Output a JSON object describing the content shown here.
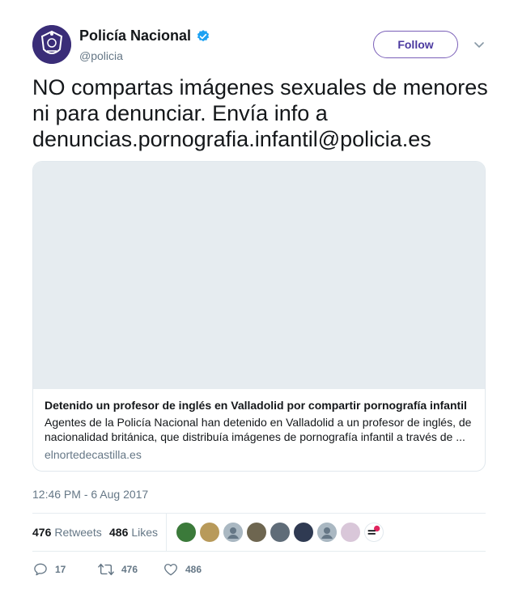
{
  "author": {
    "display_name": "Policía Nacional",
    "handle": "@policia",
    "verified": true,
    "avatar_color": "#3a2d78"
  },
  "follow_button": {
    "label": "Follow",
    "border_color": "#7a5fb8"
  },
  "tweet": {
    "text": "NO compartas imágenes sexuales de menores ni para denunciar. Envía info a denuncias.pornografia.infantil@policia.es",
    "timestamp": "12:46 PM - 6 Aug 2017"
  },
  "card": {
    "title": "Detenido un profesor de inglés en Valladolid por compartir pornografía infantil",
    "description": "Agentes de la Policía Nacional han detenido en Valladolid a un profesor de inglés, de nacionalidad británica, que distribuía imágenes de pornografía infantil a través de ...",
    "domain": "elnortedecastilla.es"
  },
  "stats": {
    "retweets_count": "476",
    "retweets_label": "Retweets",
    "likes_count": "486",
    "likes_label": "Likes"
  },
  "likers": [
    {
      "color": "#3b7a3a"
    },
    {
      "color": "#b89a5a"
    },
    {
      "color": "#aab8c2"
    },
    {
      "color": "#6e6650"
    },
    {
      "color": "#5f6c78"
    },
    {
      "color": "#2f3a52"
    },
    {
      "color": "#aab8c2"
    },
    {
      "color": "#d9c7d9"
    },
    {
      "color": "#ffffff"
    }
  ],
  "actions": {
    "replies": "17",
    "retweets": "476",
    "likes": "486"
  },
  "icons": {
    "verified": "verified-badge-icon",
    "caret": "chevron-down-icon",
    "reply": "reply-icon",
    "retweet": "retweet-icon",
    "like": "heart-icon"
  }
}
